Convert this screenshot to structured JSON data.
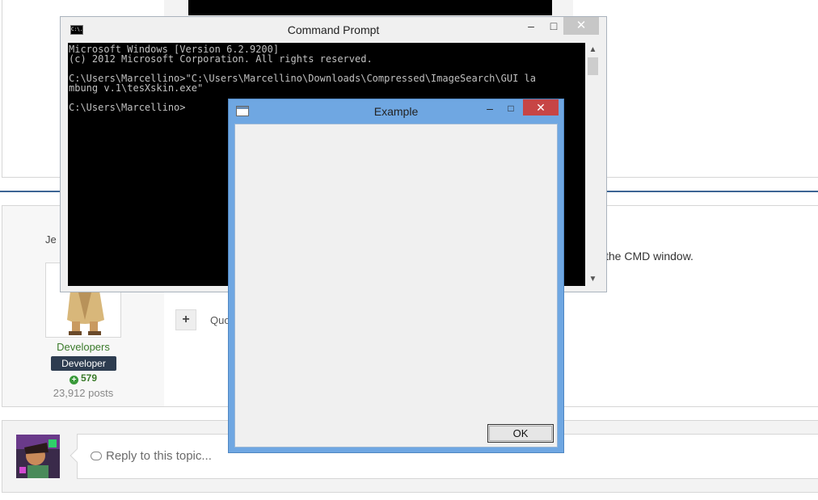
{
  "forum": {
    "author": {
      "name_partial": "Je r",
      "group": "Developers",
      "badge": "Developer",
      "reputation": "579",
      "posts": "23,912 posts"
    },
    "post_text_partial": "the CMD window.",
    "quote_label_partial": "Quo",
    "quote_plus": "+",
    "reply_placeholder": "Reply to this topic..."
  },
  "cmd": {
    "title": "Command Prompt",
    "icon_text": "C:\\.",
    "lines": [
      "Microsoft Windows [Version 6.2.9200]",
      "(c) 2012 Microsoft Corporation. All rights reserved.",
      "",
      "C:\\Users\\Marcellino>\"C:\\Users\\Marcellino\\Downloads\\Compressed\\ImageSearch\\GUI la",
      "mbung v.1\\tesXskin.exe\"",
      "",
      "C:\\Users\\Marcellino>"
    ],
    "minimize_glyph": "–",
    "maximize_glyph": "□",
    "close_glyph": "✕"
  },
  "dialog": {
    "title": "Example",
    "ok_label": "OK",
    "minimize_glyph": "–",
    "maximize_glyph": "□",
    "close_glyph": "✕"
  },
  "colors": {
    "dialog_frame": "#6fa7e2",
    "dialog_close": "#c74545",
    "console_bg": "#000000",
    "console_text": "#c0c0c0",
    "badge_bg": "#2d3c50",
    "group_text": "#3a7a2a"
  }
}
